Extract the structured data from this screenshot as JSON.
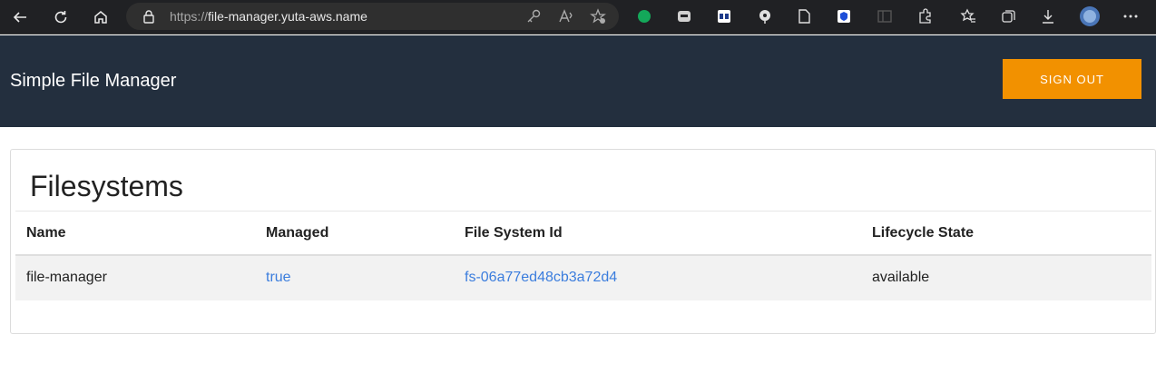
{
  "browser": {
    "url_scheme": "https://",
    "url_host": "file-manager.yuta-aws.name",
    "icons": [
      "back-icon",
      "refresh-icon",
      "home-icon",
      "lock-icon",
      "key-icon",
      "read-aloud-icon",
      "add-favorite-icon",
      "evernote-extension-icon",
      "chat-extension-icon",
      "remote-extension-icon",
      "bug-extension-icon",
      "page-extension-icon",
      "shield-extension-icon",
      "sidebar-extension-icon",
      "extensions-icon",
      "favorites-icon",
      "collections-icon",
      "downloads-icon",
      "profile-avatar",
      "more-icon"
    ]
  },
  "header": {
    "title": "Simple File Manager",
    "sign_out_label": "SIGN OUT",
    "background": "#232f3e",
    "accent": "#f29100"
  },
  "main": {
    "section_title": "Filesystems",
    "columns": [
      "Name",
      "Managed",
      "File System Id",
      "Lifecycle State"
    ],
    "rows": [
      {
        "name": "file-manager",
        "managed": "true",
        "file_system_id": "fs-06a77ed48cb3a72d4",
        "lifecycle_state": "available"
      }
    ],
    "link_color": "#3b7ddd"
  }
}
